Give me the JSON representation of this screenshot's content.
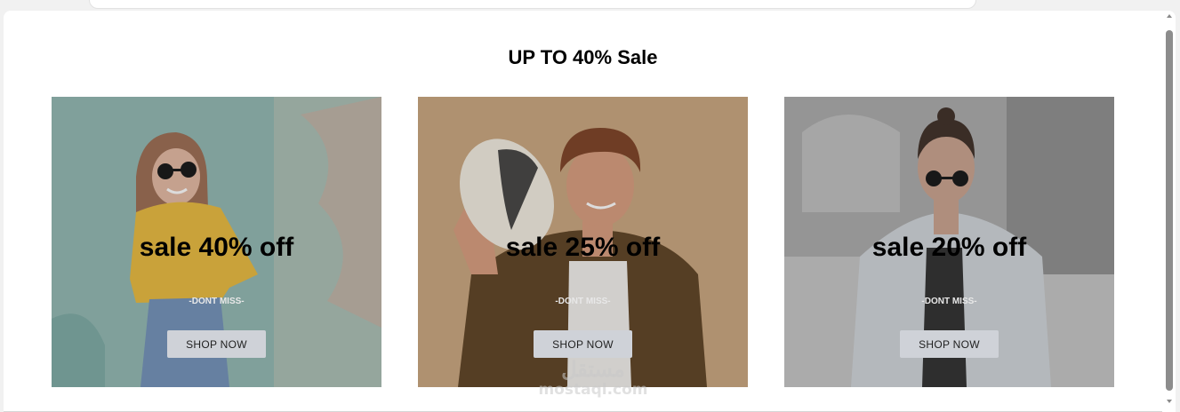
{
  "section": {
    "title": "UP TO 40% Sale"
  },
  "cards": [
    {
      "headline": "sale 40% off",
      "tagline": "-DONT MISS-",
      "button": "SHOP NOW"
    },
    {
      "headline": "sale 25% off",
      "tagline": "-DONT MISS-",
      "button": "SHOP NOW"
    },
    {
      "headline": "sale 20% off",
      "tagline": "-DONT MISS-",
      "button": "SHOP NOW"
    }
  ],
  "watermark": {
    "arabic": "مستقل",
    "latin": "mostaql.com"
  },
  "colors": {
    "card1_bg": "#8fb6b0",
    "card2_bg": "#c9a47c",
    "card3_bg": "#a9a9a9",
    "button_bg": "#cfd2d8"
  },
  "icons": [
    "scroll-up-arrow-icon",
    "scroll-down-arrow-icon"
  ]
}
